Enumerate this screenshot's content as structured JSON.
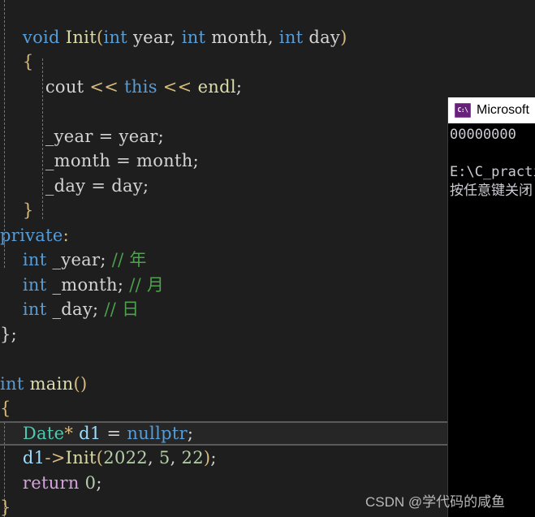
{
  "editor": {
    "background_color": "#1e1e1e",
    "current_line_background": "#262626",
    "indent_guide_color": "#767676",
    "lines": [
      {
        "indent": 0,
        "text": ""
      },
      {
        "indent": 0,
        "text": "    void Init(int year, int month, int day)"
      },
      {
        "indent": 0,
        "text": "    {"
      },
      {
        "indent": 0,
        "text": "        cout << this << endl;"
      },
      {
        "indent": 0,
        "text": ""
      },
      {
        "indent": 0,
        "text": "        _year = year;"
      },
      {
        "indent": 0,
        "text": "        _month = month;"
      },
      {
        "indent": 0,
        "text": "        _day = day;"
      },
      {
        "indent": 0,
        "text": "    }"
      },
      {
        "indent": 0,
        "text": "private:"
      },
      {
        "indent": 0,
        "text": "    int _year; // 年"
      },
      {
        "indent": 0,
        "text": "    int _month; // 月"
      },
      {
        "indent": 0,
        "text": "    int _day; // 日"
      },
      {
        "indent": 0,
        "text": "};"
      },
      {
        "indent": 0,
        "text": ""
      },
      {
        "indent": 0,
        "text": "int main()"
      },
      {
        "indent": 0,
        "text": "{"
      },
      {
        "indent": 0,
        "text": "    Date* d1 = nullptr;"
      },
      {
        "indent": 0,
        "text": "    d1->Init(2022, 5, 22);"
      },
      {
        "indent": 0,
        "text": "    return 0;"
      },
      {
        "indent": 0,
        "text": "}"
      }
    ],
    "current_line_index": 17,
    "tokens": {
      "l1": [
        "void",
        "Init",
        "(",
        "int",
        " year, ",
        "int",
        " month, ",
        "int",
        " day",
        ")"
      ],
      "l3": [
        "cout",
        "<<",
        "this",
        "<<",
        "endl",
        ";"
      ],
      "l5": [
        "_year",
        "=",
        "year",
        ";"
      ],
      "l6": [
        "_month",
        "=",
        "month",
        ";"
      ],
      "l7": [
        "_day",
        "=",
        "day",
        ";"
      ],
      "l9": [
        "private",
        ":"
      ],
      "l10": [
        "int",
        "_year",
        ";",
        "// 年"
      ],
      "l11": [
        "int",
        "_month",
        ";",
        "// 月"
      ],
      "l12": [
        "int",
        "_day",
        ";",
        "// 日"
      ],
      "l13": [
        "}",
        ";"
      ],
      "l15": [
        "int",
        "main",
        "(",
        ")"
      ],
      "l17": [
        "Date",
        "*",
        "d1",
        "=",
        "nullptr",
        ";"
      ],
      "l18": [
        "d1",
        "->",
        "Init",
        "(",
        "2022",
        ",",
        "5",
        ",",
        "22",
        ")",
        ";"
      ],
      "l19": [
        "return",
        "0",
        ";"
      ]
    },
    "colors": {
      "keyword": "#569cd6",
      "control_keyword": "#d8a0df",
      "function": "#dcdcaa",
      "type": "#4ec9b0",
      "variable": "#9cdcfe",
      "number": "#b5cea8",
      "comment": "#4ea24e",
      "operator": "#d7ba7d",
      "plain": "#d4d4d4"
    }
  },
  "code": {
    "line1_void": "void",
    "line1_init": "Init",
    "line1_p_open": "(",
    "line1_int1": "int",
    "line1_year": " year, ",
    "line1_int2": "int",
    "line1_month": " month, ",
    "line1_int3": "int",
    "line1_day": " day",
    "line1_p_close": ")",
    "line2_brace": "{",
    "line3_cout": "cout",
    "line3_shift1": " << ",
    "line3_this": "this",
    "line3_shift2": " << ",
    "line3_endl": "endl",
    "line3_semi": ";",
    "line5_lhs": "_year",
    "line5_eq": " = ",
    "line5_rhs": "year",
    "line5_semi": ";",
    "line6_lhs": "_month",
    "line6_eq": " = ",
    "line6_rhs": "month",
    "line6_semi": ";",
    "line7_lhs": "_day",
    "line7_eq": " = ",
    "line7_rhs": "day",
    "line7_semi": ";",
    "line8_brace": "}",
    "line9_private": "private",
    "line9_colon": ":",
    "line10_int": "int",
    "line10_name": " _year",
    "line10_semi": ";",
    "line10_comment": " // 年",
    "line11_int": "int",
    "line11_name": " _month",
    "line11_semi": ";",
    "line11_comment": " // 月",
    "line12_int": "int",
    "line12_name": " _day",
    "line12_semi": ";",
    "line12_comment": " // 日",
    "line13_close": "};",
    "line15_int": "int",
    "line15_main": " main",
    "line15_parens": "()",
    "line16_brace": "{",
    "line17_type": "Date",
    "line17_star": "*",
    "line17_var": " d1",
    "line17_eq": " = ",
    "line17_null": "nullptr",
    "line17_semi": ";",
    "line18_var": "d1",
    "line18_arrow": "->",
    "line18_fn": "Init",
    "line18_p_open": "(",
    "line18_n1": "2022",
    "line18_c1": ", ",
    "line18_n2": "5",
    "line18_c2": ", ",
    "line18_n3": "22",
    "line18_p_close": ")",
    "line18_semi": ";",
    "line19_return": "return",
    "line19_zero": " 0",
    "line19_semi": ";",
    "line20_brace": "}"
  },
  "console": {
    "icon_label": "C:\\",
    "title": "Microsoft",
    "output_lines": [
      "00000000",
      "",
      "E:\\C_practi",
      "按任意键关闭"
    ],
    "background_color": "#000000",
    "titlebar_color": "#ffffff",
    "text_color": "#ccccd4"
  },
  "watermark": {
    "text": "CSDN @学代码的咸鱼"
  }
}
